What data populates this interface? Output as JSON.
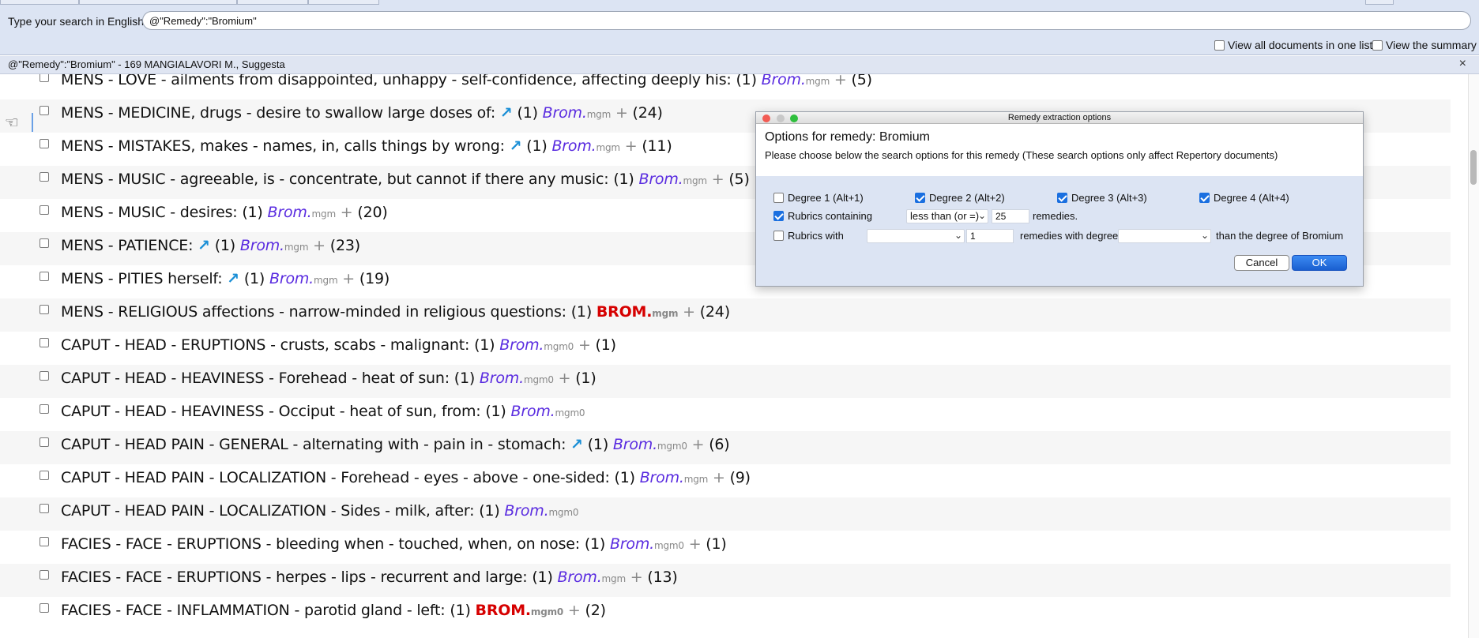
{
  "search": {
    "label": "Type your search in English:",
    "value": "@\"Remedy\":\"Bromium\""
  },
  "options": {
    "view_all_docs": "View all documents in one list",
    "view_summary": "View the summary"
  },
  "result_bar": {
    "title": "@\"Remedy\":\"Bromium\" - 169 MANGIALAVORI M., Suggesta",
    "close": "×"
  },
  "rows": [
    {
      "rubric": "MENS - LOVE - ailments from disappointed, unhappy - self-confidence, affecting deeply his:",
      "arrow": "",
      "count": "(1)",
      "remedy": "Brom.",
      "source": "mgm",
      "extra": "(5)"
    },
    {
      "rubric": "MENS - MEDICINE, drugs - desire to swallow large doses of:",
      "arrow": "↗",
      "count": "(1)",
      "remedy": "Brom.",
      "source": "mgm",
      "extra": "(24)"
    },
    {
      "rubric": "MENS - MISTAKES, makes - names, in, calls things by wrong:",
      "arrow": "↗",
      "count": "(1)",
      "remedy": "Brom.",
      "source": "mgm",
      "extra": "(11)"
    },
    {
      "rubric": "MENS - MUSIC - agreeable, is - concentrate, but cannot if there any music:",
      "arrow": "",
      "count": "(1)",
      "remedy": "Brom.",
      "source": "mgm",
      "extra": "(5)"
    },
    {
      "rubric": "MENS - MUSIC - desires:",
      "arrow": "",
      "count": "(1)",
      "remedy": "Brom.",
      "source": "mgm",
      "extra": "(20)"
    },
    {
      "rubric": "MENS - PATIENCE:",
      "arrow": "↗",
      "count": "(1)",
      "remedy": "Brom.",
      "source": "mgm",
      "extra": "(23)"
    },
    {
      "rubric": "MENS - PITIES herself:",
      "arrow": "↗",
      "count": "(1)",
      "remedy": "Brom.",
      "source": "mgm",
      "extra": "(19)"
    },
    {
      "rubric": "MENS - RELIGIOUS affections - narrow-minded in religious questions:",
      "arrow": "",
      "count": "(1)",
      "remedy": "BROM.",
      "source": "mgm",
      "extra": "(24)"
    },
    {
      "rubric": "CAPUT - HEAD - ERUPTIONS - crusts, scabs - malignant:",
      "arrow": "",
      "count": "(1)",
      "remedy": "Brom.",
      "source": "mgm0",
      "extra": "(1)"
    },
    {
      "rubric": "CAPUT - HEAD - HEAVINESS - Forehead - heat of sun:",
      "arrow": "",
      "count": "(1)",
      "remedy": "Brom.",
      "source": "mgm0",
      "extra": "(1)"
    },
    {
      "rubric": "CAPUT - HEAD - HEAVINESS - Occiput - heat of sun, from:",
      "arrow": "",
      "count": "(1)",
      "remedy": "Brom.",
      "source": "mgm0",
      "extra": ""
    },
    {
      "rubric": "CAPUT - HEAD PAIN - GENERAL - alternating with - pain in - stomach:",
      "arrow": "↗",
      "count": "(1)",
      "remedy": "Brom.",
      "source": "mgm0",
      "extra": "(6)"
    },
    {
      "rubric": "CAPUT - HEAD PAIN - LOCALIZATION - Forehead - eyes - above - one-sided:",
      "arrow": "",
      "count": "(1)",
      "remedy": "Brom.",
      "source": "mgm",
      "extra": "(9)"
    },
    {
      "rubric": "CAPUT - HEAD PAIN - LOCALIZATION - Sides - milk, after:",
      "arrow": "",
      "count": "(1)",
      "remedy": "Brom.",
      "source": "mgm0",
      "extra": ""
    },
    {
      "rubric": "FACIES - FACE - ERUPTIONS - bleeding when - touched, when, on nose:",
      "arrow": "",
      "count": "(1)",
      "remedy": "Brom.",
      "source": "mgm0",
      "extra": "(1)"
    },
    {
      "rubric": "FACIES - FACE - ERUPTIONS - herpes - lips - recurrent and large:",
      "arrow": "",
      "count": "(1)",
      "remedy": "Brom.",
      "source": "mgm",
      "extra": "(13)"
    },
    {
      "rubric": "FACIES - FACE - INFLAMMATION - parotid gland - left:",
      "arrow": "",
      "count": "(1)",
      "remedy": "BROM.",
      "source": "mgm0",
      "extra": "(2)"
    }
  ],
  "dialog": {
    "title": "Remedy extraction options",
    "heading": "Options for remedy: Bromium",
    "subtitle": "Please choose below the search options for this remedy (These search options only affect Repertory documents)",
    "degree1": "Degree 1 (Alt+1)",
    "degree2": "Degree 2 (Alt+2)",
    "degree3": "Degree 3 (Alt+3)",
    "degree4": "Degree 4 (Alt+4)",
    "rubrics_containing": "Rubrics containing",
    "less_than": "less than (or =)",
    "count_value": "25",
    "remedies": "remedies.",
    "rubrics_with": "Rubrics with",
    "with_value": "1",
    "remedies_with_degree": "remedies with degree",
    "than_degree": "than the degree of Bromium",
    "cancel": "Cancel",
    "ok": "OK"
  },
  "colors": {
    "remedy_normal": "#5a2ce0",
    "remedy_strong": "#d60000",
    "arrow": "#1a8fd6",
    "ok_button": "#1a5fd0"
  }
}
